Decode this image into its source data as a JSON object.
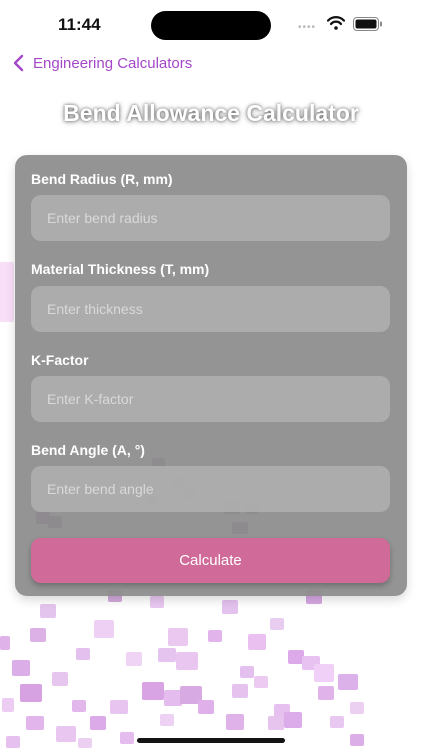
{
  "status_bar": {
    "time": "11:44",
    "icons": [
      "signal-dots-icon",
      "wifi-icon",
      "battery-icon"
    ]
  },
  "nav": {
    "back_label": "Engineering Calculators",
    "back_icon": "chevron-left-icon",
    "accent_color": "#a347c8"
  },
  "title": "Bend Allowance Calculator",
  "form": {
    "fields": [
      {
        "label": "Bend Radius (R, mm)",
        "placeholder": "Enter bend radius",
        "value": ""
      },
      {
        "label": "Material Thickness (T, mm)",
        "placeholder": "Enter thickness",
        "value": ""
      },
      {
        "label": "K-Factor",
        "placeholder": "Enter K-factor",
        "value": ""
      },
      {
        "label": "Bend Angle (A, °)",
        "placeholder": "Enter bend angle",
        "value": ""
      }
    ],
    "submit_label": "Calculate",
    "button_color": "#d06a98",
    "card_color": "#8c8c8c"
  }
}
